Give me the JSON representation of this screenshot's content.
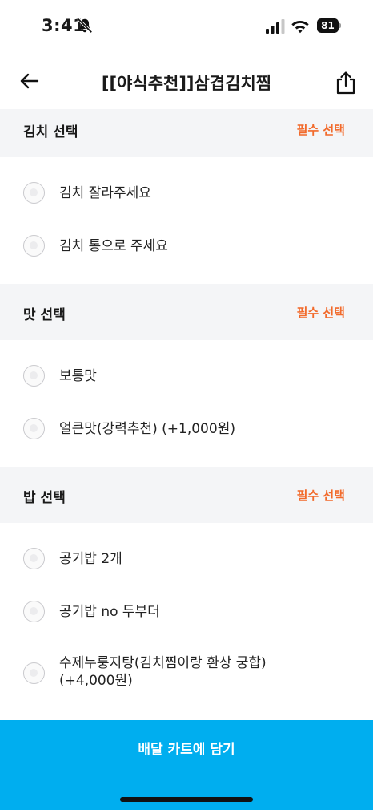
{
  "status_bar": {
    "time": "3:41",
    "battery": "81"
  },
  "header": {
    "title": "[[야식추천]]삼겹김치찜"
  },
  "sections": [
    {
      "title": "김치 선택",
      "badge": "필수 선택",
      "options": [
        {
          "lines": [
            "김치 잘라주세요"
          ]
        },
        {
          "lines": [
            "김치 통으로 주세요"
          ]
        }
      ]
    },
    {
      "title": "맛 선택",
      "badge": "필수 선택",
      "options": [
        {
          "lines": [
            "보통맛"
          ]
        },
        {
          "lines": [
            "얼큰맛(강력추천) (+1,000원)"
          ]
        }
      ]
    },
    {
      "title": "밥 선택",
      "badge": "필수 선택",
      "options": [
        {
          "lines": [
            "공기밥 2개"
          ]
        },
        {
          "lines": [
            "공기밥 no 두부더"
          ]
        },
        {
          "lines": [
            "수제누룽지탕(김치찜이랑 환상 궁합)",
            "(+4,000원)"
          ]
        }
      ]
    }
  ],
  "cta": {
    "label": "배달 카트에 담기"
  },
  "colors": {
    "accent": "#00aeef",
    "required": "#f26a2b",
    "section_bg": "#f4f5f7"
  }
}
